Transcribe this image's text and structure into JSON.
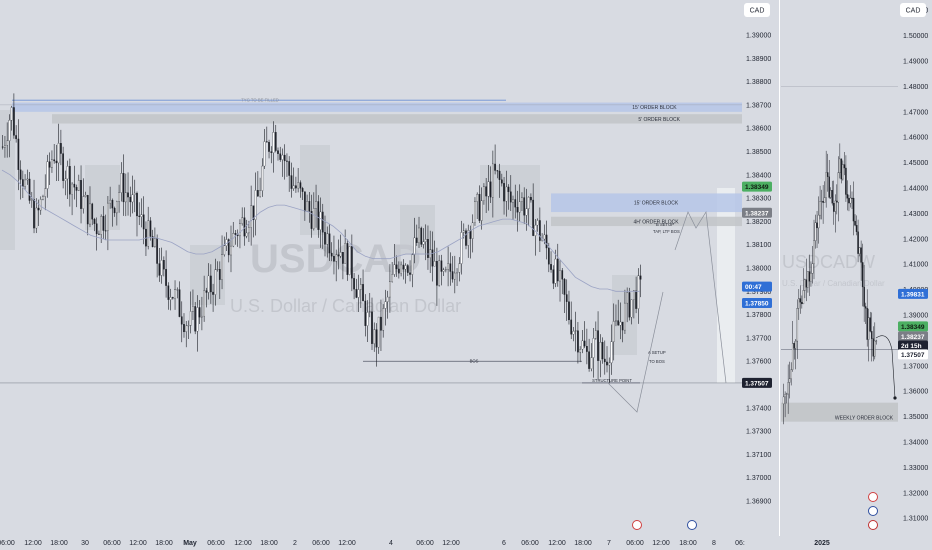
{
  "currency_label": "CAD",
  "watermark": {
    "symbol": "USDCAD",
    "name": "U.S. Dollar / Canadian Dollar",
    "symbol_right": "USDCADW",
    "name_right": "U.S. Dollar / Canadian Dollar"
  },
  "chart_data": [
    {
      "type": "candlestick",
      "panel": "left",
      "ylim": [
        1.3685,
        1.3915
      ],
      "y_ticks": [
        1.39,
        1.389,
        1.388,
        1.387,
        1.386,
        1.385,
        1.384,
        1.383,
        1.382,
        1.381,
        1.38,
        1.379,
        1.378,
        1.377,
        1.376,
        1.374,
        1.373,
        1.372,
        1.371,
        1.37,
        1.369
      ],
      "y_tick_labels": [
        "1.39000",
        "1.38900",
        "1.38800",
        "1.38700",
        "1.38600",
        "1.38500",
        "1.38400",
        "1.38300",
        "1.38200",
        "1.38100",
        "1.38000",
        "1.37900",
        "1.37800",
        "1.37700",
        "1.37600",
        "1.37400",
        "1.37300",
        "1.37100",
        "1.37000",
        "1.36900"
      ],
      "x_tick_labels": [
        "06:00",
        "12:00",
        "18:00",
        "30",
        "06:00",
        "12:00",
        "18:00",
        "May",
        "06:00",
        "12:00",
        "18:00",
        "2",
        "06:00",
        "12:00",
        "4",
        "06:00",
        "12:00",
        "6",
        "06:00",
        "12:00",
        "18:00",
        "7",
        "06:00",
        "12:00",
        "18:00",
        "8",
        "06:"
      ],
      "price_path": [
        1.3852,
        1.3868,
        1.3845,
        1.383,
        1.382,
        1.3835,
        1.385,
        1.3845,
        1.3838,
        1.3832,
        1.3825,
        1.3818,
        1.3822,
        1.3828,
        1.3835,
        1.383,
        1.3822,
        1.3815,
        1.3806,
        1.3795,
        1.379,
        1.3782,
        1.3775,
        1.378,
        1.3788,
        1.3795,
        1.3803,
        1.3812,
        1.3818,
        1.3823,
        1.3827,
        1.385,
        1.3858,
        1.385,
        1.3838,
        1.3832,
        1.3825,
        1.3822,
        1.3815,
        1.381,
        1.3808,
        1.3802,
        1.379,
        1.3778,
        1.3768,
        1.378,
        1.3795,
        1.3805,
        1.3802,
        1.3812,
        1.3808,
        1.38,
        1.3793,
        1.38,
        1.3808,
        1.3818,
        1.3825,
        1.383,
        1.384,
        1.3835,
        1.3828,
        1.383,
        1.3825,
        1.3818,
        1.381,
        1.38,
        1.379,
        1.3778,
        1.377,
        1.3762,
        1.3768,
        1.376,
        1.377,
        1.3778,
        1.3785,
        1.379,
        1.3788,
        1.3785,
        1.3788,
        1.3786
      ],
      "series": [
        {
          "name": "",
          "type": "ema",
          "values": [
            1.3842,
            1.384,
            1.3837,
            1.3833,
            1.3829,
            1.3826,
            1.3824,
            1.3822,
            1.382,
            1.3818,
            1.3816,
            1.3814,
            1.3813,
            1.3812,
            1.3812,
            1.3812,
            1.3812,
            1.3812,
            1.3813,
            1.3813,
            1.3812,
            1.3811,
            1.3809,
            1.3807,
            1.3806,
            1.3806,
            1.3807,
            1.3809,
            1.3811,
            1.3814,
            1.3817,
            1.3821,
            1.3824,
            1.3826,
            1.3827,
            1.3827,
            1.3826,
            1.3825,
            1.3824,
            1.3822,
            1.382,
            1.3818,
            1.3815,
            1.3811,
            1.3807,
            1.3805,
            1.3804,
            1.3804,
            1.3804,
            1.3805,
            1.3806,
            1.3806,
            1.3806,
            1.3806,
            1.3807,
            1.3809,
            1.3811,
            1.3813,
            1.3816,
            1.3818,
            1.3819,
            1.382,
            1.3821,
            1.3821,
            1.382,
            1.3819,
            1.3816,
            1.3812,
            1.3808,
            1.3804,
            1.38,
            1.3796,
            1.3794,
            1.3792,
            1.3791,
            1.3791,
            1.379,
            1.379,
            1.379,
            1.379
          ]
        }
      ],
      "zones": [
        {
          "label": "15' ORDER BLOCK",
          "y_top": 1.3871,
          "y_bottom": 1.3867,
          "color": "#b6c6e8"
        },
        {
          "label": "5' ORDER BLOCK",
          "y_top": 1.3866,
          "y_bottom": 1.3862,
          "color": "#c2c4c8"
        },
        {
          "label": "15' ORDER BLOCK",
          "y_top": 1.3832,
          "y_bottom": 1.3824,
          "color": "#b6c6e8"
        },
        {
          "label": "4H' ORDER BLOCK",
          "y_top": 1.3822,
          "y_bottom": 1.3818,
          "color": "#c2c4c8"
        }
      ],
      "levels": [
        {
          "label": "TYG TO BE FILLED",
          "y": 1.3872
        },
        {
          "label": "BOS",
          "y": 1.376
        },
        {
          "label": "STRUCTURE POINT",
          "y": 1.37507
        }
      ],
      "annotations": [
        "B SETUP",
        "TAP, LTF BOS",
        "A SETUP",
        "TO BOS"
      ],
      "price_tags": [
        {
          "value": "1.38349",
          "y": 1.38349,
          "bg": "#4caf62",
          "fg": "#0e1a10"
        },
        {
          "value": "1.38237",
          "y": 1.38237,
          "bg": "#7b7e86",
          "fg": "#ffffff"
        },
        {
          "value": "00:47",
          "y": 1.3792,
          "bg": "#2f6fd6",
          "fg": "#ffffff"
        },
        {
          "value": "1.37850",
          "y": 1.3785,
          "bg": "#2f6fd6",
          "fg": "#ffffff"
        },
        {
          "value": "1.37507",
          "y": 1.37507,
          "bg": "#1e2230",
          "fg": "#ffffff"
        }
      ]
    },
    {
      "type": "candlestick",
      "panel": "right",
      "ylim": [
        1.303,
        1.514
      ],
      "y_ticks": [
        1.51,
        1.5,
        1.49,
        1.48,
        1.47,
        1.46,
        1.45,
        1.44,
        1.43,
        1.42,
        1.41,
        1.4,
        1.39,
        1.37,
        1.36,
        1.35,
        1.34,
        1.33,
        1.32,
        1.31
      ],
      "y_tick_labels": [
        "1.51000",
        "1.50000",
        "1.49000",
        "1.48000",
        "1.47000",
        "1.46000",
        "1.45000",
        "1.44000",
        "1.43000",
        "1.42000",
        "1.41000",
        "1.40000",
        "1.39000",
        "1.37000",
        "1.36000",
        "1.35000",
        "1.34000",
        "1.33000",
        "1.32000",
        "1.31000"
      ],
      "x_tick_labels": [
        "2025"
      ],
      "price_path": [
        1.355,
        1.362,
        1.37,
        1.378,
        1.385,
        1.392,
        1.396,
        1.4,
        1.406,
        1.412,
        1.42,
        1.428,
        1.433,
        1.44,
        1.442,
        1.438,
        1.43,
        1.439,
        1.445,
        1.45,
        1.442,
        1.44,
        1.435,
        1.43,
        1.42,
        1.41,
        1.398,
        1.386,
        1.383,
        1.379,
        1.375
      ],
      "zones": [
        {
          "label": "WEEKLY ORDER BLOCK",
          "y_top": 1.3555,
          "y_bottom": 1.348,
          "color": "#c2c4c8"
        }
      ],
      "price_tags": [
        {
          "value": "1.39831",
          "y": 1.3983,
          "bg": "#2f6fd6",
          "fg": "#ffffff"
        },
        {
          "value": "1.38349",
          "y": 1.3855,
          "bg": "#4caf62",
          "fg": "#0e1a10"
        },
        {
          "value": "1.38237",
          "y": 1.3816,
          "bg": "#7b7e86",
          "fg": "#ffffff"
        },
        {
          "value": "2d 15h",
          "y": 1.378,
          "bg": "#1e2230",
          "fg": "#ffffff"
        },
        {
          "value": "1.37507",
          "y": 1.3745,
          "bg": "#ffffff",
          "fg": "#1e2230"
        }
      ]
    }
  ]
}
